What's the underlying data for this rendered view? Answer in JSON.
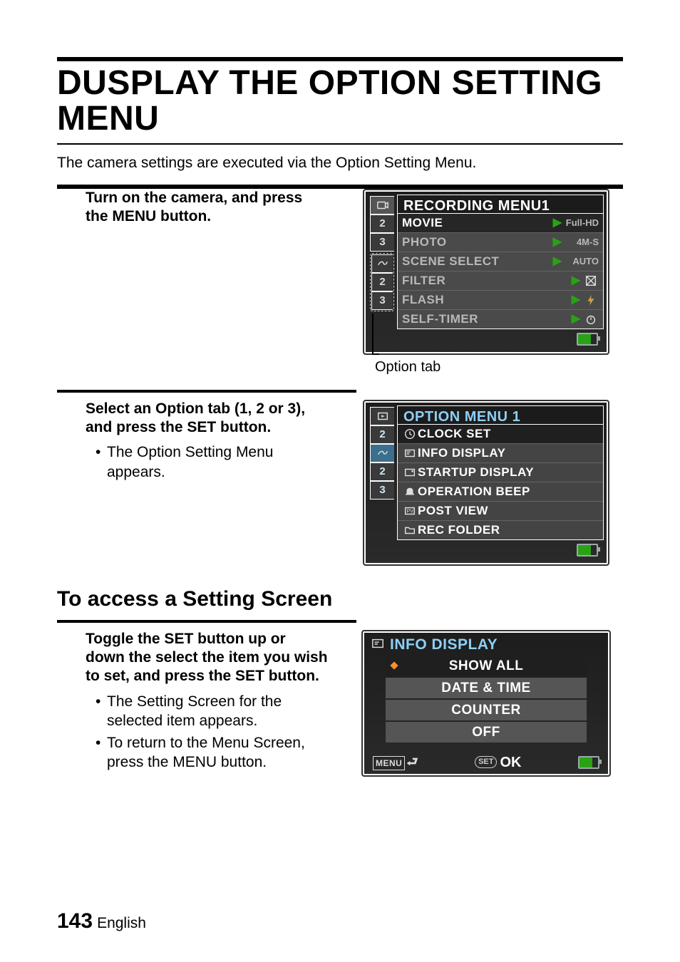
{
  "page": {
    "title": "DUSPLAY THE OPTION SETTING MENU",
    "intro": "The camera settings are executed via the Option Setting Menu.",
    "section2_title": "To access a Setting Screen",
    "page_number": "143",
    "language": "English"
  },
  "step1": {
    "heading": "Turn on the camera, and press the MENU button.",
    "callout": "Option tab"
  },
  "step2": {
    "heading": "Select an Option tab (1, 2 or 3), and press the SET button.",
    "bullets": [
      "The Option Setting Menu appears."
    ]
  },
  "step3": {
    "heading": "Toggle the SET button up or down the select the item you wish to set, and press the SET button.",
    "bullets": [
      "The Setting Screen for the selected item appears.",
      "To return to the Menu Screen, press the MENU button."
    ]
  },
  "lcd_rec": {
    "title": "RECORDING MENU1",
    "tabs_upper": [
      "",
      "2",
      "3"
    ],
    "tabs_lower": [
      "1",
      "2",
      "3"
    ],
    "rows": [
      {
        "label": "MOVIE",
        "value": "Full-HD"
      },
      {
        "label": "PHOTO",
        "value": "4M-S"
      },
      {
        "label": "SCENE SELECT",
        "value": "AUTO"
      },
      {
        "label": "FILTER",
        "value": ""
      },
      {
        "label": "FLASH",
        "value": ""
      },
      {
        "label": "SELF-TIMER",
        "value": ""
      }
    ]
  },
  "lcd_opt": {
    "title": "OPTION MENU 1",
    "tabs_upper": [
      "1",
      "2"
    ],
    "tabs_lower": [
      "1",
      "2",
      "3"
    ],
    "rows": [
      {
        "label": "CLOCK SET"
      },
      {
        "label": "INFO DISPLAY"
      },
      {
        "label": "STARTUP DISPLAY"
      },
      {
        "label": "OPERATION BEEP"
      },
      {
        "label": "POST VIEW"
      },
      {
        "label": "REC FOLDER"
      }
    ]
  },
  "lcd_set": {
    "header": "INFO DISPLAY",
    "options": [
      "SHOW ALL",
      "DATE & TIME",
      "COUNTER",
      "OFF"
    ],
    "menu_label": "MENU",
    "set_label": "SET",
    "ok_label": "OK"
  }
}
